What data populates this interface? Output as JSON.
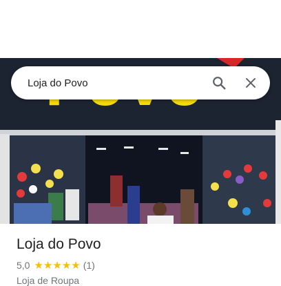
{
  "search": {
    "query": "Loja do Povo"
  },
  "hero": {
    "sign_text": "Povo"
  },
  "place": {
    "name": "Loja do Povo",
    "rating": "5,0",
    "stars": 5,
    "review_count": "(1)",
    "category": "Loja de Roupa"
  },
  "colors": {
    "star": "#fbbc04",
    "sign_letters": "#f5d90a",
    "storefront_facade": "#1d2433"
  },
  "icons": {
    "search": "search-icon",
    "close": "close-icon",
    "star": "star-icon"
  }
}
